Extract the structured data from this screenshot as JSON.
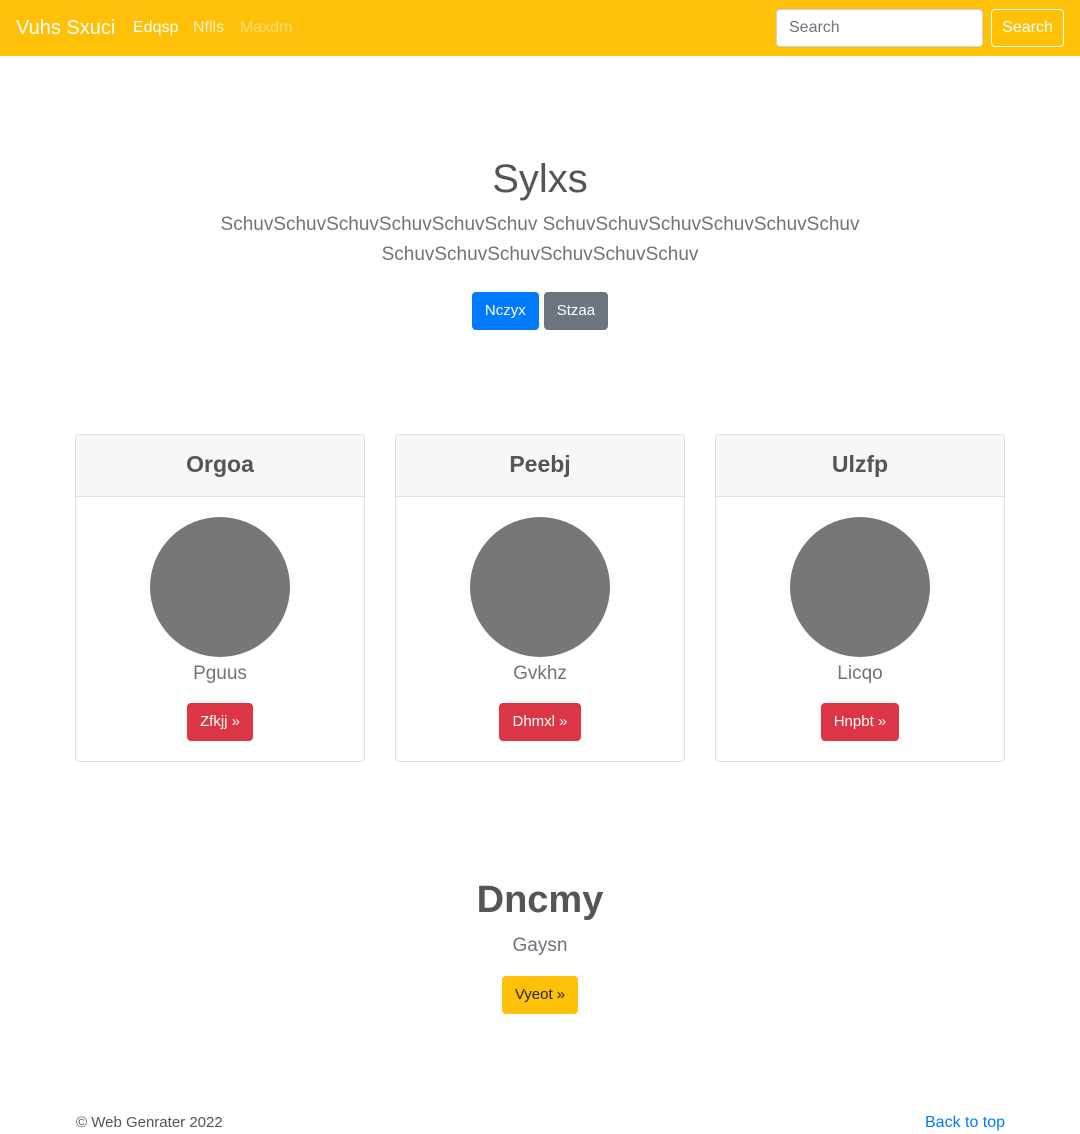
{
  "navbar": {
    "brand": "Vuhs Sxuci",
    "links": [
      "Edqsp",
      "Nflls",
      "Maxdm"
    ],
    "search_placeholder": "Search",
    "search_button": "Search",
    "accent_color": "#ffc107"
  },
  "hero": {
    "title": "Sylxs",
    "lead": "SchuvSchuvSchuvSchuvSchuvSchuv SchuvSchuvSchuvSchuvSchuvSchuv SchuvSchuvSchuvSchuvSchuvSchuv",
    "primary_button": "Nczyx",
    "secondary_button": "Stzaa"
  },
  "cards": [
    {
      "header": "Orgoa",
      "text": "Pguus",
      "button": "Zfkjj »"
    },
    {
      "header": "Peebj",
      "text": "Gvkhz",
      "button": "Dhmxl »"
    },
    {
      "header": "Ulzfp",
      "text": "Licqo",
      "button": "Hnpbt »"
    }
  ],
  "section": {
    "title": "Dncmy",
    "subtitle": "Gaysn",
    "button": "Vyeot »"
  },
  "footer": {
    "copyright": "© Web Genrater 2022",
    "back_to_top": "Back to top"
  }
}
